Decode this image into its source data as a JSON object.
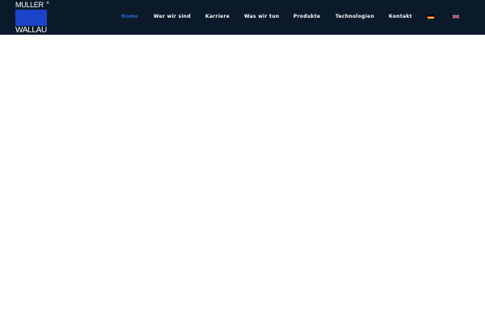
{
  "brand": {
    "logo_top": "MULLER",
    "logo_registered": "®",
    "logo_bottom": "WALLAU",
    "logo_block_color": "#1c44c9"
  },
  "header": {
    "background": "#0b1a2b"
  },
  "nav": {
    "items": [
      {
        "label": "Home",
        "active": true
      },
      {
        "label": "Wer wir sind",
        "active": false
      },
      {
        "label": "Karriere",
        "active": false
      },
      {
        "label": "Was wir tun",
        "active": false
      },
      {
        "label": "Produkte",
        "active": false
      },
      {
        "label": "Technologien",
        "active": false
      },
      {
        "label": "Kontakt",
        "active": false
      }
    ],
    "active_color": "#2f6bd6",
    "text_color": "#ffffff"
  },
  "languages": [
    {
      "icon": "german-flag-icon"
    },
    {
      "icon": "uk-flag-icon"
    }
  ]
}
